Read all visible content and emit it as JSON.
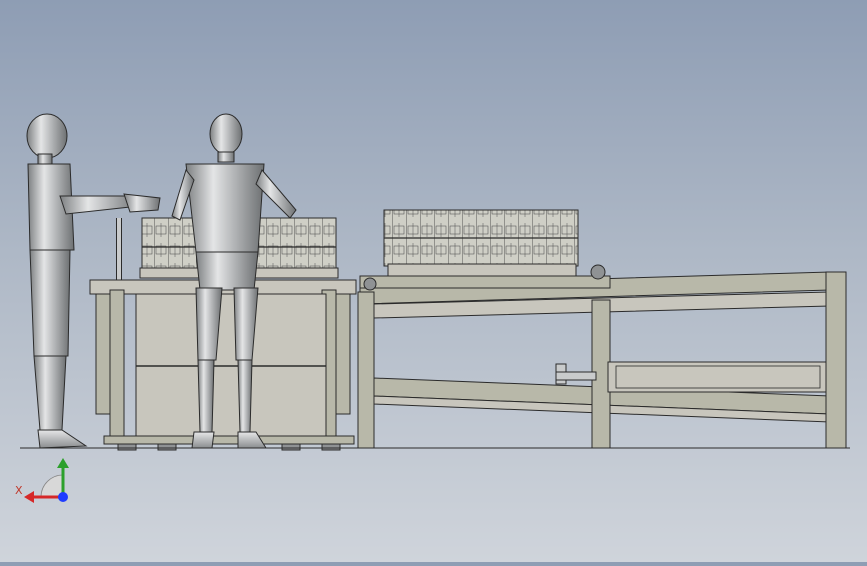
{
  "viewport": {
    "background_top": "#8e9db4",
    "background_bottom": "#cfd4db"
  },
  "model_colors": {
    "metal": "#c9cbcc",
    "metal_dark": "#8f9294",
    "edge": "#2b2b2b",
    "frame": "#b8b8a9",
    "panel": "#c8c6bd"
  },
  "triad": {
    "x_label": "X",
    "x_color": "#d62828",
    "y_color": "#2ca02c",
    "z_color": "#1f3cff"
  }
}
